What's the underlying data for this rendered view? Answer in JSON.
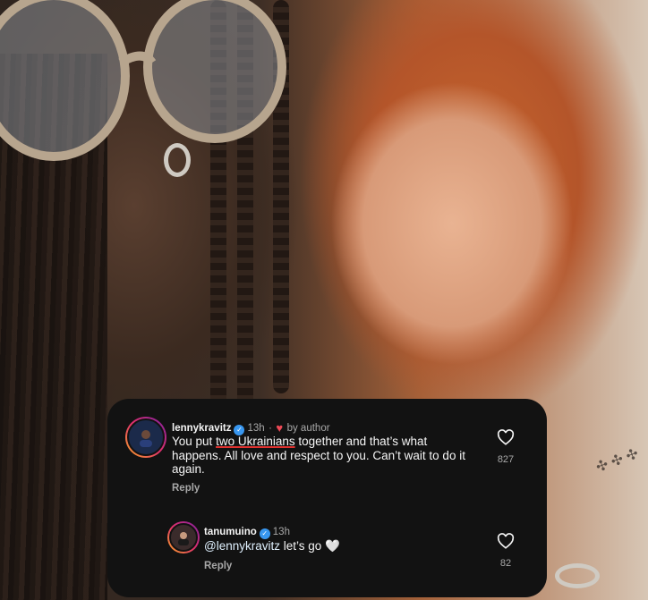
{
  "comments": [
    {
      "username": "lennykravitz",
      "time": "13h",
      "separator": "·",
      "author_badge": "by author",
      "text_before": "You put ",
      "text_highlight": "two Ukrainians",
      "text_after": " together and that’s what happens. All love and respect to you. Can’t wait to do it again.",
      "reply_label": "Reply",
      "like_count": "827",
      "verified": true
    },
    {
      "username": "tanumuino",
      "time": "13h",
      "mention": "@lennykravitz",
      "text": " let’s go 🤍",
      "reply_label": "Reply",
      "like_count": "82",
      "verified": true
    }
  ],
  "icons": {
    "verified": "verified-badge-icon",
    "heart_outline": "heart-outline-icon",
    "heart_filled": "heart-filled-icon"
  },
  "colors": {
    "card_bg": "#121212",
    "verified_blue": "#3897f0",
    "heart_red": "#ed4956",
    "secondary_text": "#a8a8a8"
  }
}
